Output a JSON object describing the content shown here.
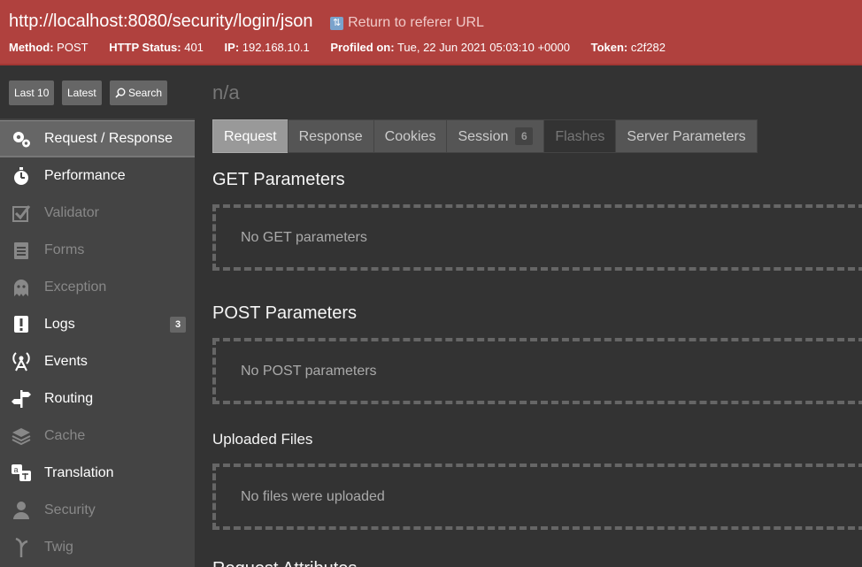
{
  "header": {
    "url": "http://localhost:8080/security/login/json",
    "return_label": "Return to referer URL",
    "method_label": "Method:",
    "method": "POST",
    "status_label": "HTTP Status:",
    "status": "401",
    "ip_label": "IP:",
    "ip": "192.168.10.1",
    "profiled_label": "Profiled on:",
    "profiled": "Tue, 22 Jun 2021 05:03:10 +0000",
    "token_label": "Token:",
    "token": "c2f282"
  },
  "sidebar": {
    "buttons": {
      "last10": "Last 10",
      "latest": "Latest",
      "search": "Search"
    },
    "items": [
      {
        "label": "Request / Response",
        "icon": "gears-icon",
        "state": "active"
      },
      {
        "label": "Performance",
        "icon": "stopwatch-icon",
        "state": "enabled"
      },
      {
        "label": "Validator",
        "icon": "checkbox-icon",
        "state": "disabled"
      },
      {
        "label": "Forms",
        "icon": "clipboard-icon",
        "state": "disabled"
      },
      {
        "label": "Exception",
        "icon": "ghost-icon",
        "state": "disabled"
      },
      {
        "label": "Logs",
        "icon": "alert-icon",
        "state": "enabled",
        "badge": "3"
      },
      {
        "label": "Events",
        "icon": "broadcast-icon",
        "state": "enabled"
      },
      {
        "label": "Routing",
        "icon": "signpost-icon",
        "state": "enabled"
      },
      {
        "label": "Cache",
        "icon": "layers-icon",
        "state": "disabled"
      },
      {
        "label": "Translation",
        "icon": "translate-icon",
        "state": "enabled"
      },
      {
        "label": "Security",
        "icon": "user-icon",
        "state": "disabled"
      },
      {
        "label": "Twig",
        "icon": "twig-icon",
        "state": "disabled"
      }
    ]
  },
  "main": {
    "title": "n/a",
    "tabs": [
      {
        "label": "Request"
      },
      {
        "label": "Response"
      },
      {
        "label": "Cookies"
      },
      {
        "label": "Session",
        "badge": "6"
      },
      {
        "label": "Flashes"
      },
      {
        "label": "Server Parameters"
      }
    ],
    "sections": [
      {
        "title": "GET Parameters",
        "empty": "No GET parameters"
      },
      {
        "title": "POST Parameters",
        "empty": "No POST parameters"
      },
      {
        "title": "Uploaded Files",
        "empty": "No files were uploaded"
      },
      {
        "title": "Request Attributes"
      }
    ]
  },
  "colors": {
    "header": "#b0413e",
    "sidebar": "#444444",
    "main": "#333333",
    "tab_active": "#999999"
  }
}
